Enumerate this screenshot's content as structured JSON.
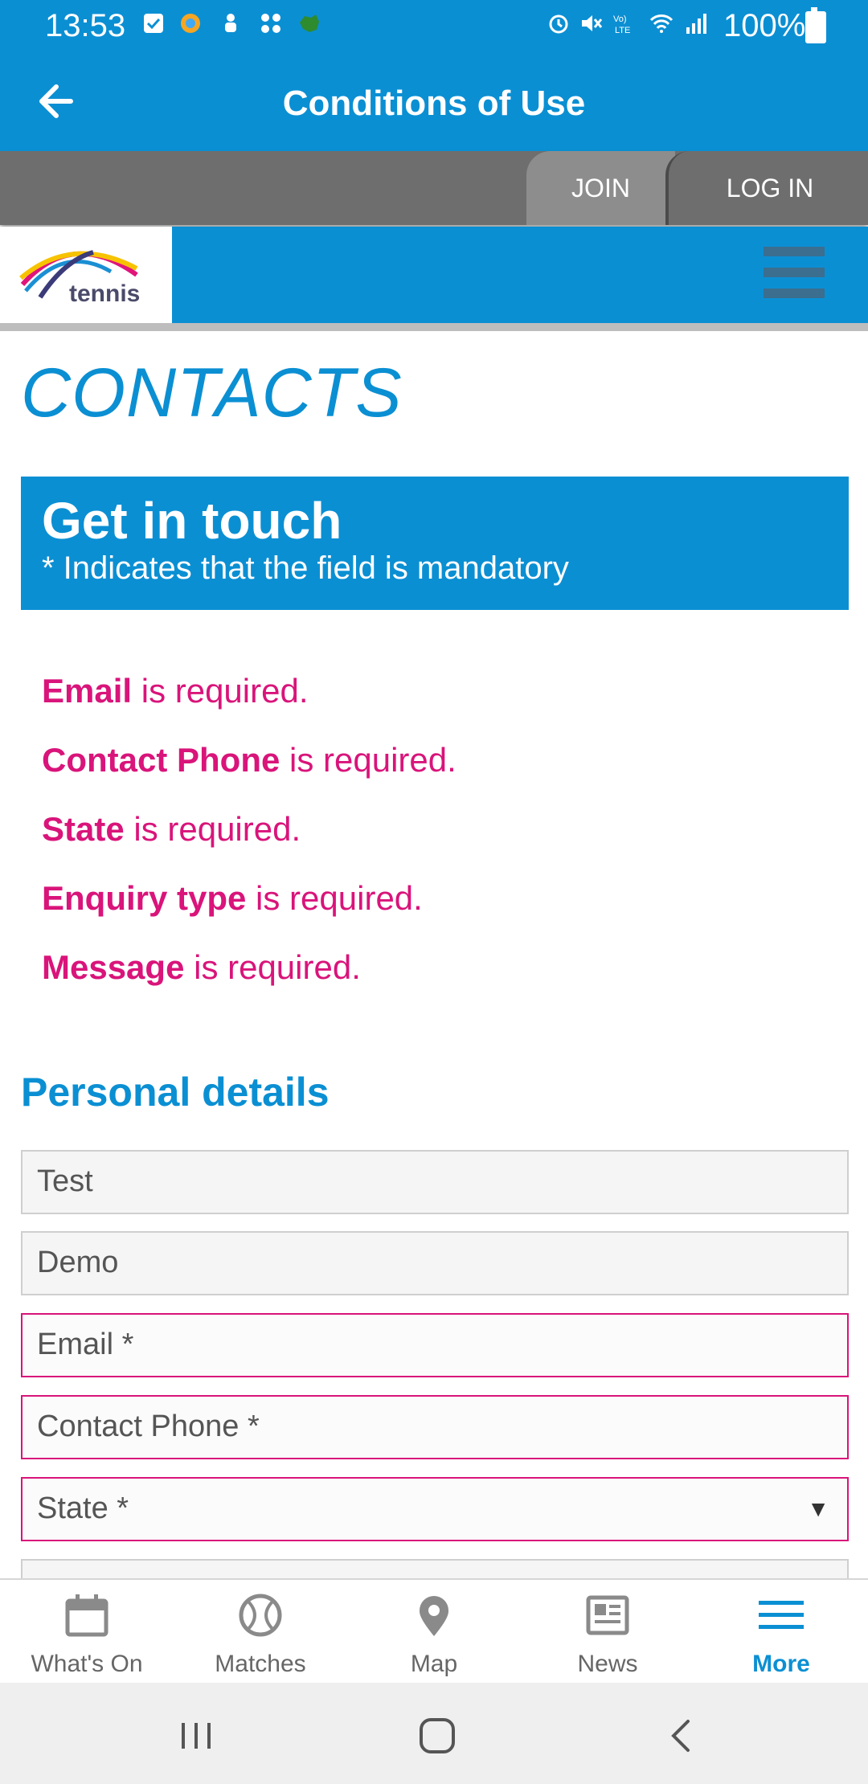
{
  "status_bar": {
    "time": "13:53",
    "battery": "100%"
  },
  "app_bar": {
    "title": "Conditions of Use"
  },
  "auth": {
    "join": "JOIN",
    "login": "LOG IN"
  },
  "site": {
    "logo_text": "tennis"
  },
  "page": {
    "title": "CONTACTS",
    "touch_title": "Get in touch",
    "touch_subtitle": "* Indicates that the field is mandatory"
  },
  "errors": [
    {
      "field": "Email",
      "text": " is required."
    },
    {
      "field": "Contact Phone",
      "text": " is required."
    },
    {
      "field": "State",
      "text": " is required."
    },
    {
      "field": "Enquiry type",
      "text": " is required."
    },
    {
      "field": "Message",
      "text": " is required."
    }
  ],
  "form": {
    "section_title": "Personal details",
    "first_name_value": "Test",
    "last_name_value": "Demo",
    "email_placeholder": "Email *",
    "phone_placeholder": "Contact Phone *",
    "state_selected": "State *"
  },
  "bottom_nav": [
    {
      "label": "What's On"
    },
    {
      "label": "Matches"
    },
    {
      "label": "Map"
    },
    {
      "label": "News"
    },
    {
      "label": "More"
    }
  ],
  "colors": {
    "brand_blue": "#0b8fd3",
    "error_pink": "#d9147a"
  }
}
